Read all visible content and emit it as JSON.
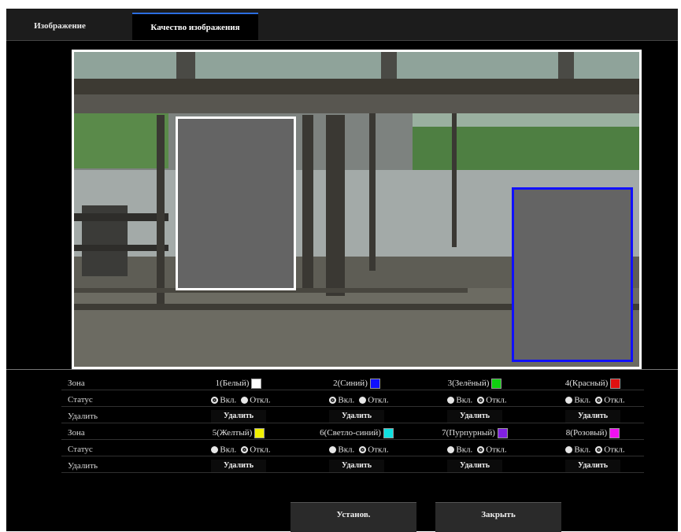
{
  "tabs": [
    "Изображение",
    "Качество изображения"
  ],
  "zones": [
    {
      "label": "1(Белый)",
      "color": "#ffffff",
      "status": "on"
    },
    {
      "label": "2(Синий)",
      "color": "#1010ff",
      "status": "on"
    },
    {
      "label": "3(Зелёный)",
      "color": "#10d010",
      "status": "off"
    },
    {
      "label": "4(Красный)",
      "color": "#e01010",
      "status": "off"
    },
    {
      "label": "5(Желтый)",
      "color": "#f0f000",
      "status": "off"
    },
    {
      "label": "6(Светло-синий)",
      "color": "#10e0e0",
      "status": "off"
    },
    {
      "label": "7(Пурпурный)",
      "color": "#8020e0",
      "status": "off"
    },
    {
      "label": "8(Розовый)",
      "color": "#f010f0",
      "status": "off"
    }
  ],
  "labels": {
    "zone": "Зона",
    "status": "Статус",
    "delete": "Удалить",
    "on": "Вкл.",
    "off": "Откл.",
    "delete_button": "Удалить"
  },
  "buttons": {
    "set": "Установ.",
    "close": "Закрыть"
  }
}
